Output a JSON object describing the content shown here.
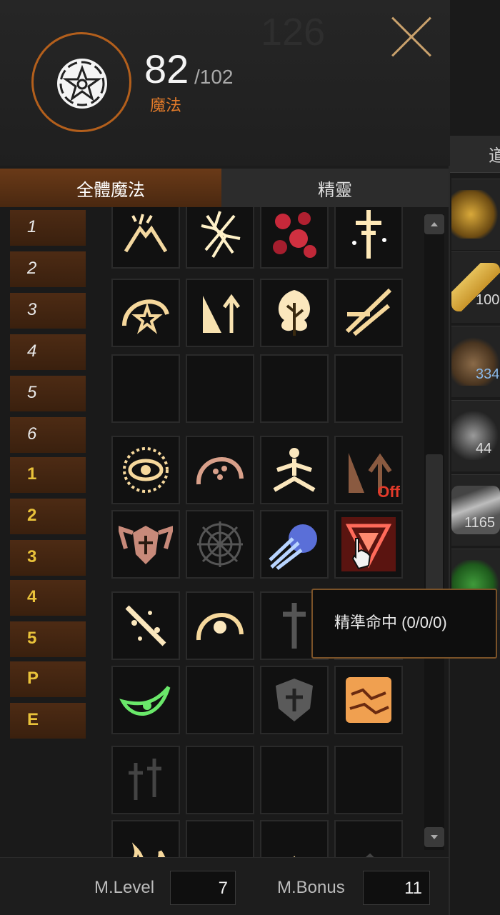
{
  "header": {
    "mp_current": "82",
    "mp_max": "/102",
    "mp_label": "魔法",
    "background_count": "126"
  },
  "tabs": [
    {
      "label": "全體魔法",
      "active": true
    },
    {
      "label": "精靈",
      "active": false
    }
  ],
  "level_rows": [
    {
      "label": "1",
      "color": "white"
    },
    {
      "label": "2",
      "color": "white"
    },
    {
      "label": "3",
      "color": "white"
    },
    {
      "label": "4",
      "color": "white"
    },
    {
      "label": "5",
      "color": "white"
    },
    {
      "label": "6",
      "color": "white"
    },
    {
      "label": "1",
      "color": "yellow"
    },
    {
      "label": "2",
      "color": "yellow"
    },
    {
      "label": "3",
      "color": "yellow"
    },
    {
      "label": "4",
      "color": "yellow"
    },
    {
      "label": "5",
      "color": "yellow"
    },
    {
      "label": "P",
      "color": "yellow"
    },
    {
      "label": "E",
      "color": "yellow"
    }
  ],
  "skill_rows": [
    [
      "volcano-icon",
      "crack-icon",
      "blood-drops-icon",
      "sword-cross-icon"
    ],
    [
      "wave-star-icon",
      "arrow-bind-icon",
      "tree-icon",
      "claw-strike-icon"
    ],
    [
      "",
      "",
      "",
      ""
    ],
    [
      "eye-sun-icon",
      "paw-bubble-icon",
      "meditate-icon",
      "tree-arrow-icon"
    ],
    [
      "wing-shield-icon",
      "web-icon",
      "ice-comet-icon",
      "triangle-mark-icon"
    ],
    [
      "sparkle-staff-icon",
      "sun-wave-icon",
      "dark-sword-icon",
      ""
    ],
    [
      "green-eye-icon",
      "",
      "shield-cross-icon",
      "lava-icon"
    ],
    [
      "dagger-pair-icon",
      "",
      "",
      ""
    ],
    [
      "flame-icon",
      "curve-icon",
      "small-flame-icon",
      "faded-icon"
    ]
  ],
  "off_label": "Off",
  "tooltip": "精準命中 (0/0/0)",
  "footer": {
    "mlevel_label": "M.Level",
    "mlevel_value": "7",
    "mbonus_label": "M.Bonus",
    "mbonus_value": "11"
  },
  "inventory": [
    {
      "icon": "gold-ring-icon",
      "count": ""
    },
    {
      "icon": "gold-bar-icon",
      "count": "100"
    },
    {
      "icon": "money-bag-icon",
      "count": "334"
    },
    {
      "icon": "gem-icon",
      "count": "44"
    },
    {
      "icon": "silver-item-icon",
      "count": "1165"
    },
    {
      "icon": "green-item-icon",
      "count": ""
    }
  ],
  "inventory_tab_label": "道",
  "colors": {
    "accent": "#e37b2a",
    "tab_active": "#5a3216",
    "level_yellow": "#e9c23a",
    "tooltip_border": "#7a5228"
  }
}
